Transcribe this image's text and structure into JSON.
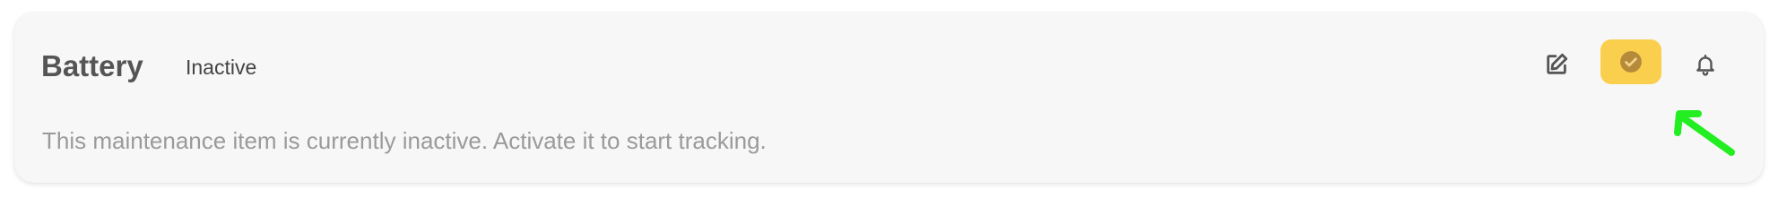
{
  "card": {
    "title": "Battery",
    "status_badge": "Inactive",
    "description": "This maintenance item is currently inactive. Activate it to start tracking."
  },
  "actions": {
    "edit_icon": "edit-icon",
    "activate_icon": "check-circle-icon",
    "notifications_icon": "bell-icon"
  },
  "colors": {
    "card_background": "#f7f7f7",
    "activate_background": "#fbcf4e",
    "activate_icon": "#b58a3a",
    "title_text": "#555555",
    "description_text": "#9a9a9a",
    "annotation_arrow": "#22ee22"
  }
}
